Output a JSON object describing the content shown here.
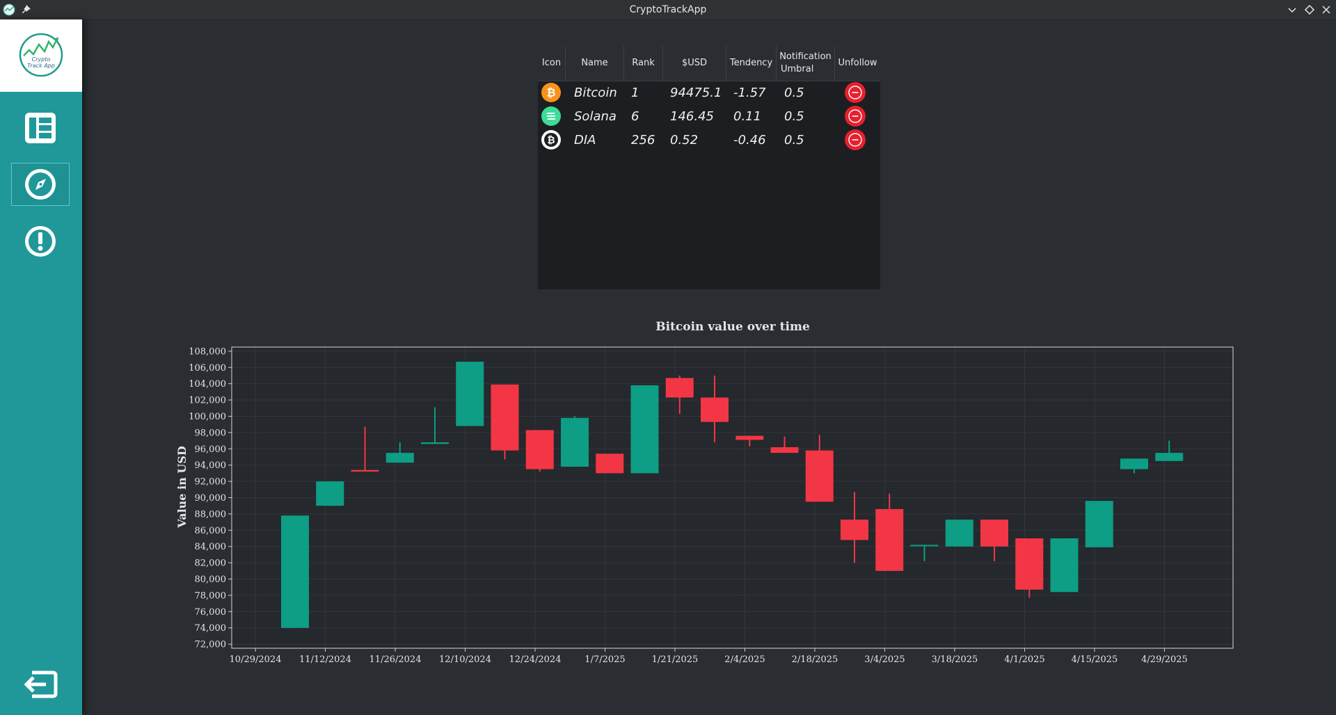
{
  "window": {
    "title": "CryptoTrackApp"
  },
  "sidebar": {
    "logo_text_line1": "Crypto",
    "logo_text_line2": "Track App",
    "items": [
      {
        "icon": "dashboard-icon",
        "active": false
      },
      {
        "icon": "compass-icon",
        "active": true
      },
      {
        "icon": "alert-icon",
        "active": false
      },
      {
        "icon": "logout-icon",
        "active": false
      }
    ]
  },
  "table": {
    "headers": [
      "Icon",
      "Name",
      "Rank",
      "$USD",
      "Tendency",
      "Notification Umbral",
      "Unfollow"
    ],
    "header_umbral_line1": "Notification",
    "header_umbral_line2": "Umbral",
    "rows": [
      {
        "icon": "bitcoin-icon",
        "icon_color": "#f7931a",
        "name": "Bitcoin",
        "rank": "1",
        "usd": "94475.1",
        "tendency": "-1.57",
        "umbral": "0.5"
      },
      {
        "icon": "solana-icon",
        "icon_color": "#3ddc97",
        "name": "Solana",
        "rank": "6",
        "usd": "146.45",
        "tendency": "0.11",
        "umbral": "0.5"
      },
      {
        "icon": "dia-icon",
        "icon_color": "#ffffff",
        "name": "DIA",
        "rank": "256",
        "usd": "0.52",
        "tendency": "-0.46",
        "umbral": "0.5"
      }
    ]
  },
  "chart_data": {
    "type": "candlestick",
    "title": "Bitcoin value over time",
    "ylabel": "Value in USD",
    "xlabel": "",
    "ylim": [
      71500,
      108500
    ],
    "y_ticks": [
      72000,
      74000,
      76000,
      78000,
      80000,
      82000,
      84000,
      86000,
      88000,
      90000,
      92000,
      94000,
      96000,
      98000,
      100000,
      102000,
      104000,
      106000,
      108000
    ],
    "y_tick_labels": [
      "72,000",
      "74,000",
      "76,000",
      "78,000",
      "80,000",
      "82,000",
      "84,000",
      "86,000",
      "88,000",
      "90,000",
      "92,000",
      "94,000",
      "96,000",
      "98,000",
      "100,000",
      "102,000",
      "104,000",
      "106,000",
      "108,000"
    ],
    "x_ticks": [
      "10/29/2024",
      "11/12/2024",
      "11/26/2024",
      "12/10/2024",
      "12/24/2024",
      "1/7/2025",
      "1/21/2025",
      "2/4/2025",
      "2/18/2025",
      "3/4/2025",
      "3/18/2025",
      "4/1/2025",
      "4/15/2025",
      "4/29/2025"
    ],
    "grid": true,
    "up_color": "#0d9e85",
    "down_color": "#f23645",
    "candles": [
      {
        "open": 74000,
        "close": 87800,
        "high": 87800,
        "low": 74000
      },
      {
        "open": 89000,
        "close": 92000,
        "high": 92000,
        "low": 89000
      },
      {
        "open": 93400,
        "close": 93200,
        "high": 98700,
        "low": 93200
      },
      {
        "open": 94300,
        "close": 95500,
        "high": 96800,
        "low": 94300
      },
      {
        "open": 96600,
        "close": 96800,
        "high": 101100,
        "low": 96600
      },
      {
        "open": 98800,
        "close": 106700,
        "high": 106700,
        "low": 98800
      },
      {
        "open": 103900,
        "close": 95800,
        "high": 103900,
        "low": 94700
      },
      {
        "open": 98300,
        "close": 93500,
        "high": 98300,
        "low": 93200
      },
      {
        "open": 93800,
        "close": 99800,
        "high": 100000,
        "low": 93800
      },
      {
        "open": 95400,
        "close": 93000,
        "high": 95400,
        "low": 93000
      },
      {
        "open": 93000,
        "close": 103800,
        "high": 103800,
        "low": 93000
      },
      {
        "open": 104700,
        "close": 102300,
        "high": 105000,
        "low": 100300
      },
      {
        "open": 102300,
        "close": 99300,
        "high": 105000,
        "low": 96800
      },
      {
        "open": 97600,
        "close": 97100,
        "high": 97600,
        "low": 96300
      },
      {
        "open": 96200,
        "close": 95500,
        "high": 97500,
        "low": 95500
      },
      {
        "open": 95800,
        "close": 89500,
        "high": 97700,
        "low": 89500
      },
      {
        "open": 87300,
        "close": 84800,
        "high": 90700,
        "low": 82000
      },
      {
        "open": 88600,
        "close": 81000,
        "high": 90500,
        "low": 81000
      },
      {
        "open": 84200,
        "close": 84200,
        "high": 84200,
        "low": 82200
      },
      {
        "open": 84000,
        "close": 87300,
        "high": 87300,
        "low": 84000
      },
      {
        "open": 87300,
        "close": 84000,
        "high": 87300,
        "low": 82200
      },
      {
        "open": 85000,
        "close": 78700,
        "high": 85000,
        "low": 77700
      },
      {
        "open": 78400,
        "close": 85000,
        "high": 85000,
        "low": 78400
      },
      {
        "open": 83900,
        "close": 89600,
        "high": 89600,
        "low": 83900
      },
      {
        "open": 93500,
        "close": 94800,
        "high": 94800,
        "low": 93000
      },
      {
        "open": 94500,
        "close": 95500,
        "high": 97000,
        "low": 94500
      }
    ]
  }
}
